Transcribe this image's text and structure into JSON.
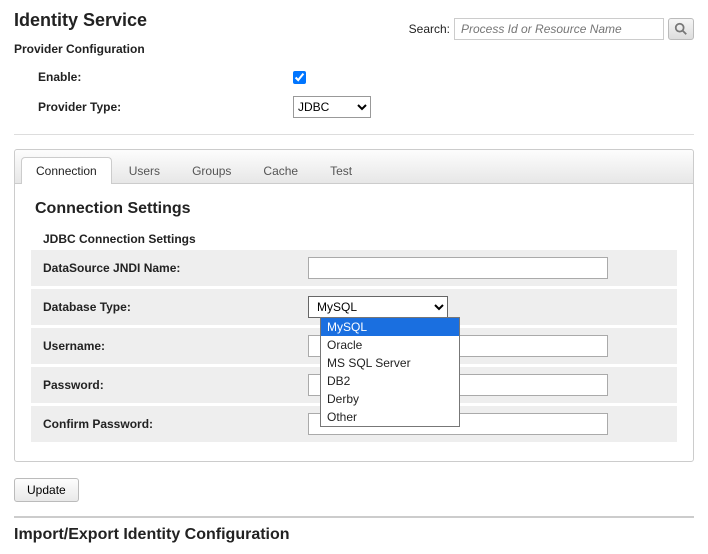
{
  "header": {
    "title": "Identity Service",
    "subtitle": "Provider Configuration",
    "search_label": "Search:",
    "search_placeholder": "Process Id or Resource Name"
  },
  "provider": {
    "enable_label": "Enable:",
    "enable_checked": true,
    "type_label": "Provider Type:",
    "type_value": "JDBC"
  },
  "tabs": {
    "items": [
      "Connection",
      "Users",
      "Groups",
      "Cache",
      "Test"
    ],
    "active": 0
  },
  "connection": {
    "section_title": "Connection Settings",
    "subsection_title": "JDBC Connection Settings",
    "jndi_label": "DataSource JNDI Name:",
    "jndi_value": "",
    "dbtype_label": "Database Type:",
    "dbtype_value": "MySQL",
    "dbtype_options": [
      "MySQL",
      "Oracle",
      "MS SQL Server",
      "DB2",
      "Derby",
      "Other"
    ],
    "username_label": "Username:",
    "username_value": "",
    "password_label": "Password:",
    "password_value": "",
    "confirm_label": "Confirm Password:",
    "confirm_value": ""
  },
  "buttons": {
    "update": "Update"
  },
  "import_export": {
    "title": "Import/Export Identity Configuration"
  }
}
